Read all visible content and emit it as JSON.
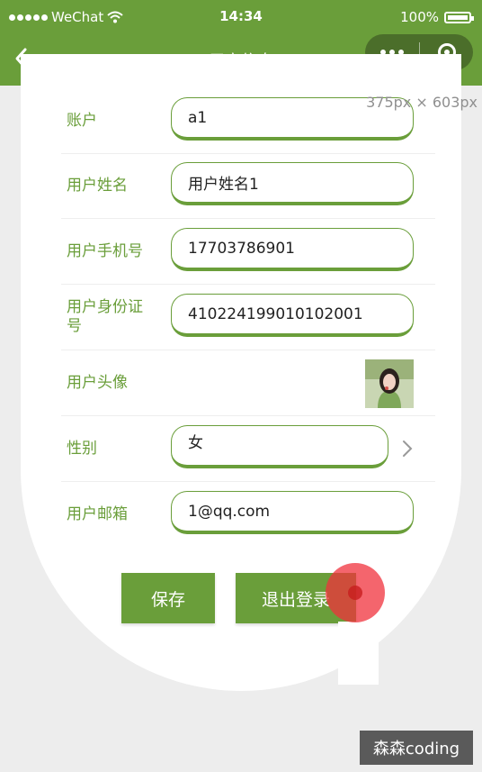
{
  "status": {
    "carrier": "WeChat",
    "time": "14:34",
    "battery": "100%"
  },
  "navbar": {
    "title": "用户信息"
  },
  "dimension_label": "375px × 603px",
  "form": {
    "account": {
      "label": "账户",
      "value": "a1"
    },
    "username": {
      "label": "用户姓名",
      "value": "用户姓名1"
    },
    "phone": {
      "label": "用户手机号",
      "value": "17703786901"
    },
    "id_card": {
      "label": "用户身份证号",
      "value": "410224199010102001"
    },
    "avatar": {
      "label": "用户头像"
    },
    "gender": {
      "label": "性别",
      "value": "女"
    },
    "email": {
      "label": "用户邮箱",
      "value": "1@qq.com"
    }
  },
  "buttons": {
    "save": "保存",
    "logout": "退出登录"
  },
  "watermark": "森森coding",
  "colors": {
    "accent": "#6a9e3a",
    "background": "#ededed"
  }
}
